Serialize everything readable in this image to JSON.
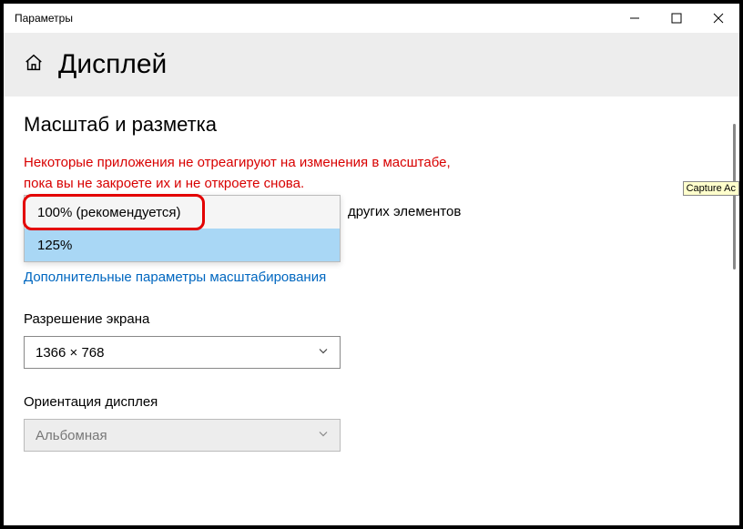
{
  "window": {
    "title": "Параметры"
  },
  "header": {
    "title": "Дисплей"
  },
  "section": {
    "heading": "Масштаб и разметка"
  },
  "warning": {
    "line1": "Некоторые приложения не отреагируют на изменения в масштабе,",
    "line2": "пока вы не закроете их и не откроете снова."
  },
  "scale": {
    "label_fragment": "других элементов",
    "options": [
      "100% (рекомендуется)",
      "125%"
    ],
    "advanced_link": "Дополнительные параметры масштабирования"
  },
  "resolution": {
    "label": "Разрешение экрана",
    "value": "1366 × 768"
  },
  "orientation": {
    "label": "Ориентация дисплея",
    "value": "Альбомная"
  },
  "capture_tooltip": "Capture Ac"
}
